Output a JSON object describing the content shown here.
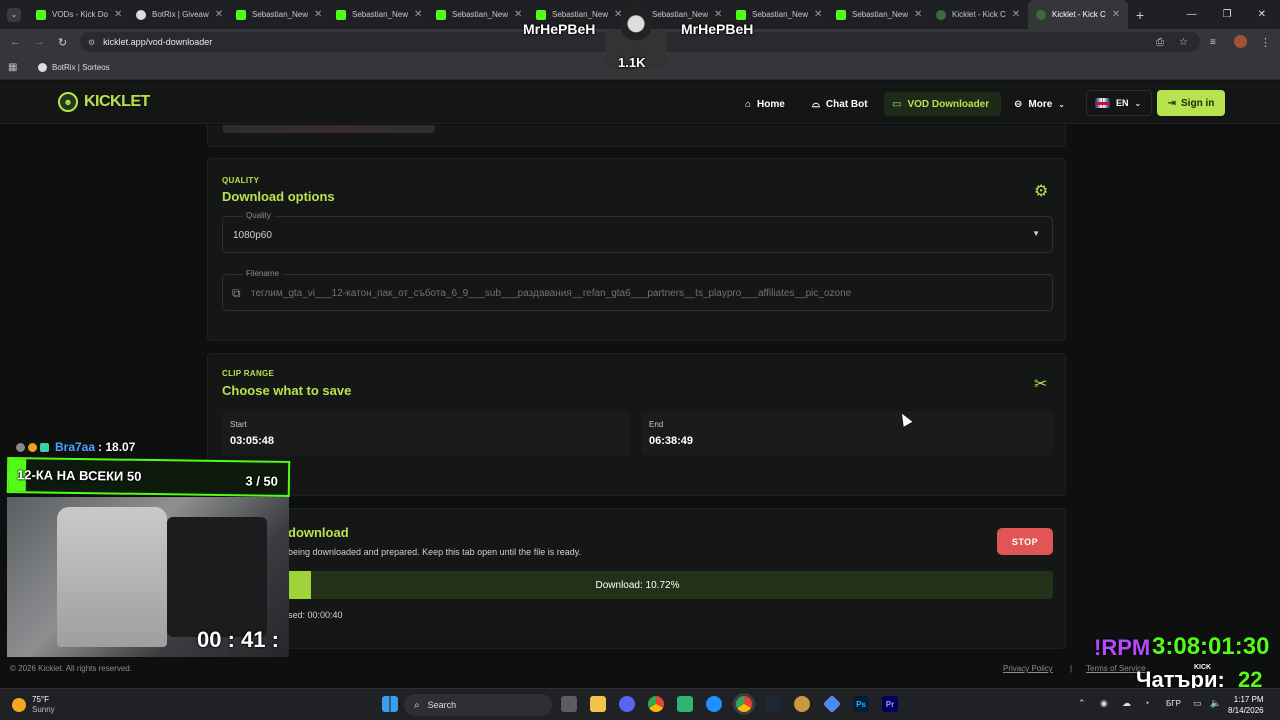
{
  "tabs": [
    {
      "label": "VODs - Kick Do"
    },
    {
      "label": "BotRix | Giveaw"
    },
    {
      "label": "Sebastian_New"
    },
    {
      "label": "Sebastian_New"
    },
    {
      "label": "Sebastian_New"
    },
    {
      "label": "Sebastian_New"
    },
    {
      "label": "Sebastian_New"
    },
    {
      "label": "Sebastian_New"
    },
    {
      "label": "Sebastian_New"
    },
    {
      "label": "Kicklet - Kick C"
    },
    {
      "label": "Kicklet - Kick C"
    }
  ],
  "address": {
    "url": "kicklet.app/vod-downloader"
  },
  "bookmarks": [
    {
      "label": "BotRix | Sorteos"
    }
  ],
  "header": {
    "brand": "KICKLET",
    "nav": [
      {
        "label": "Home"
      },
      {
        "label": "Chat Bot"
      },
      {
        "label": "VOD Downloader"
      },
      {
        "label": "More"
      }
    ],
    "lang": "EN",
    "signin": "Sign in"
  },
  "quality_card": {
    "eyebrow": "QUALITY",
    "title": "Download options",
    "quality_label": "Quality",
    "quality_value": "1080p60",
    "filename_label": "Filename",
    "filename_value": "теглим_gta_vi___12-катон_пак_от_събота_6_9___sub___раздавания__refan_gta6___partners__ts_playpro___affiliates__pic_ozone"
  },
  "clip_card": {
    "eyebrow": "CLIP RANGE",
    "title": "Choose what to save",
    "start_label": "Start",
    "start_value": "03:05:48",
    "end_label": "End",
    "end_value": "06:38:49"
  },
  "download_card": {
    "title": "download",
    "subtitle": "being downloaded and prepared. Keep this tab open until the file is ready.",
    "stop": "STOP",
    "progress_text": "Download: 10.72%",
    "progress": 0.1072,
    "elapsed": "sed: 00:00:40"
  },
  "footer": {
    "copyright": "© 2026 Kicklet. All rights reserved.",
    "privacy": "Privacy Policy",
    "separator": "|",
    "terms": "Terms of Service"
  },
  "stream_overlay": {
    "top_name_left": "MrHePBeH",
    "top_name_right": "MrHePBeH",
    "top_count": "1.1K",
    "chat_user": "Bra7aa",
    "chat_value": ": 18.07",
    "goal_text": "12-КА НА ВСЕКИ 50",
    "goal_count": "3 / 50",
    "webcam_timer": "00 : 41 :",
    "timer_label": "!RPM",
    "timer_value": "3:08:01:30",
    "chatters_label": "Чатъри:",
    "chatters_value": "22",
    "kick_label": "KICK"
  },
  "taskbar": {
    "weather_temp": "75°F",
    "weather_desc": "Sunny",
    "search": "Search",
    "lang": "БГР",
    "time": "1:17 PM",
    "date": "8/14/2026"
  },
  "colors": {
    "accent": "#b7e34e",
    "stop": "#e05555",
    "bg": "#0e0f0f"
  }
}
